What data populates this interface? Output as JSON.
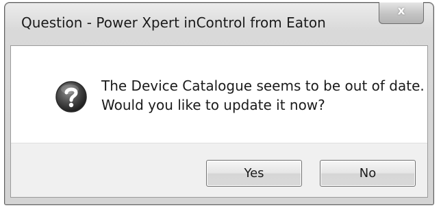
{
  "window": {
    "title": "Question - Power Xpert inControl from Eaton",
    "close_glyph": "x"
  },
  "dialog": {
    "icon": "question-icon",
    "message_line1": "The Device Catalogue seems to be out of date.",
    "message_line2": "Would you like to update it now?"
  },
  "buttons": {
    "yes_label": "Yes",
    "no_label": "No"
  }
}
